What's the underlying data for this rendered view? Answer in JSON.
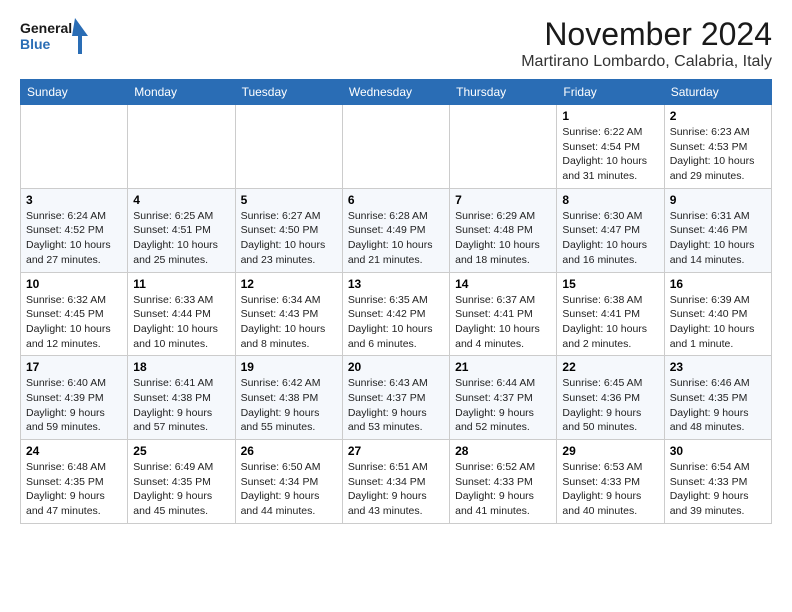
{
  "logo": {
    "line1": "General",
    "line2": "Blue"
  },
  "title": "November 2024",
  "location": "Martirano Lombardo, Calabria, Italy",
  "headers": [
    "Sunday",
    "Monday",
    "Tuesday",
    "Wednesday",
    "Thursday",
    "Friday",
    "Saturday"
  ],
  "weeks": [
    [
      {
        "day": "",
        "info": ""
      },
      {
        "day": "",
        "info": ""
      },
      {
        "day": "",
        "info": ""
      },
      {
        "day": "",
        "info": ""
      },
      {
        "day": "",
        "info": ""
      },
      {
        "day": "1",
        "info": "Sunrise: 6:22 AM\nSunset: 4:54 PM\nDaylight: 10 hours and 31 minutes."
      },
      {
        "day": "2",
        "info": "Sunrise: 6:23 AM\nSunset: 4:53 PM\nDaylight: 10 hours and 29 minutes."
      }
    ],
    [
      {
        "day": "3",
        "info": "Sunrise: 6:24 AM\nSunset: 4:52 PM\nDaylight: 10 hours and 27 minutes."
      },
      {
        "day": "4",
        "info": "Sunrise: 6:25 AM\nSunset: 4:51 PM\nDaylight: 10 hours and 25 minutes."
      },
      {
        "day": "5",
        "info": "Sunrise: 6:27 AM\nSunset: 4:50 PM\nDaylight: 10 hours and 23 minutes."
      },
      {
        "day": "6",
        "info": "Sunrise: 6:28 AM\nSunset: 4:49 PM\nDaylight: 10 hours and 21 minutes."
      },
      {
        "day": "7",
        "info": "Sunrise: 6:29 AM\nSunset: 4:48 PM\nDaylight: 10 hours and 18 minutes."
      },
      {
        "day": "8",
        "info": "Sunrise: 6:30 AM\nSunset: 4:47 PM\nDaylight: 10 hours and 16 minutes."
      },
      {
        "day": "9",
        "info": "Sunrise: 6:31 AM\nSunset: 4:46 PM\nDaylight: 10 hours and 14 minutes."
      }
    ],
    [
      {
        "day": "10",
        "info": "Sunrise: 6:32 AM\nSunset: 4:45 PM\nDaylight: 10 hours and 12 minutes."
      },
      {
        "day": "11",
        "info": "Sunrise: 6:33 AM\nSunset: 4:44 PM\nDaylight: 10 hours and 10 minutes."
      },
      {
        "day": "12",
        "info": "Sunrise: 6:34 AM\nSunset: 4:43 PM\nDaylight: 10 hours and 8 minutes."
      },
      {
        "day": "13",
        "info": "Sunrise: 6:35 AM\nSunset: 4:42 PM\nDaylight: 10 hours and 6 minutes."
      },
      {
        "day": "14",
        "info": "Sunrise: 6:37 AM\nSunset: 4:41 PM\nDaylight: 10 hours and 4 minutes."
      },
      {
        "day": "15",
        "info": "Sunrise: 6:38 AM\nSunset: 4:41 PM\nDaylight: 10 hours and 2 minutes."
      },
      {
        "day": "16",
        "info": "Sunrise: 6:39 AM\nSunset: 4:40 PM\nDaylight: 10 hours and 1 minute."
      }
    ],
    [
      {
        "day": "17",
        "info": "Sunrise: 6:40 AM\nSunset: 4:39 PM\nDaylight: 9 hours and 59 minutes."
      },
      {
        "day": "18",
        "info": "Sunrise: 6:41 AM\nSunset: 4:38 PM\nDaylight: 9 hours and 57 minutes."
      },
      {
        "day": "19",
        "info": "Sunrise: 6:42 AM\nSunset: 4:38 PM\nDaylight: 9 hours and 55 minutes."
      },
      {
        "day": "20",
        "info": "Sunrise: 6:43 AM\nSunset: 4:37 PM\nDaylight: 9 hours and 53 minutes."
      },
      {
        "day": "21",
        "info": "Sunrise: 6:44 AM\nSunset: 4:37 PM\nDaylight: 9 hours and 52 minutes."
      },
      {
        "day": "22",
        "info": "Sunrise: 6:45 AM\nSunset: 4:36 PM\nDaylight: 9 hours and 50 minutes."
      },
      {
        "day": "23",
        "info": "Sunrise: 6:46 AM\nSunset: 4:35 PM\nDaylight: 9 hours and 48 minutes."
      }
    ],
    [
      {
        "day": "24",
        "info": "Sunrise: 6:48 AM\nSunset: 4:35 PM\nDaylight: 9 hours and 47 minutes."
      },
      {
        "day": "25",
        "info": "Sunrise: 6:49 AM\nSunset: 4:35 PM\nDaylight: 9 hours and 45 minutes."
      },
      {
        "day": "26",
        "info": "Sunrise: 6:50 AM\nSunset: 4:34 PM\nDaylight: 9 hours and 44 minutes."
      },
      {
        "day": "27",
        "info": "Sunrise: 6:51 AM\nSunset: 4:34 PM\nDaylight: 9 hours and 43 minutes."
      },
      {
        "day": "28",
        "info": "Sunrise: 6:52 AM\nSunset: 4:33 PM\nDaylight: 9 hours and 41 minutes."
      },
      {
        "day": "29",
        "info": "Sunrise: 6:53 AM\nSunset: 4:33 PM\nDaylight: 9 hours and 40 minutes."
      },
      {
        "day": "30",
        "info": "Sunrise: 6:54 AM\nSunset: 4:33 PM\nDaylight: 9 hours and 39 minutes."
      }
    ]
  ]
}
